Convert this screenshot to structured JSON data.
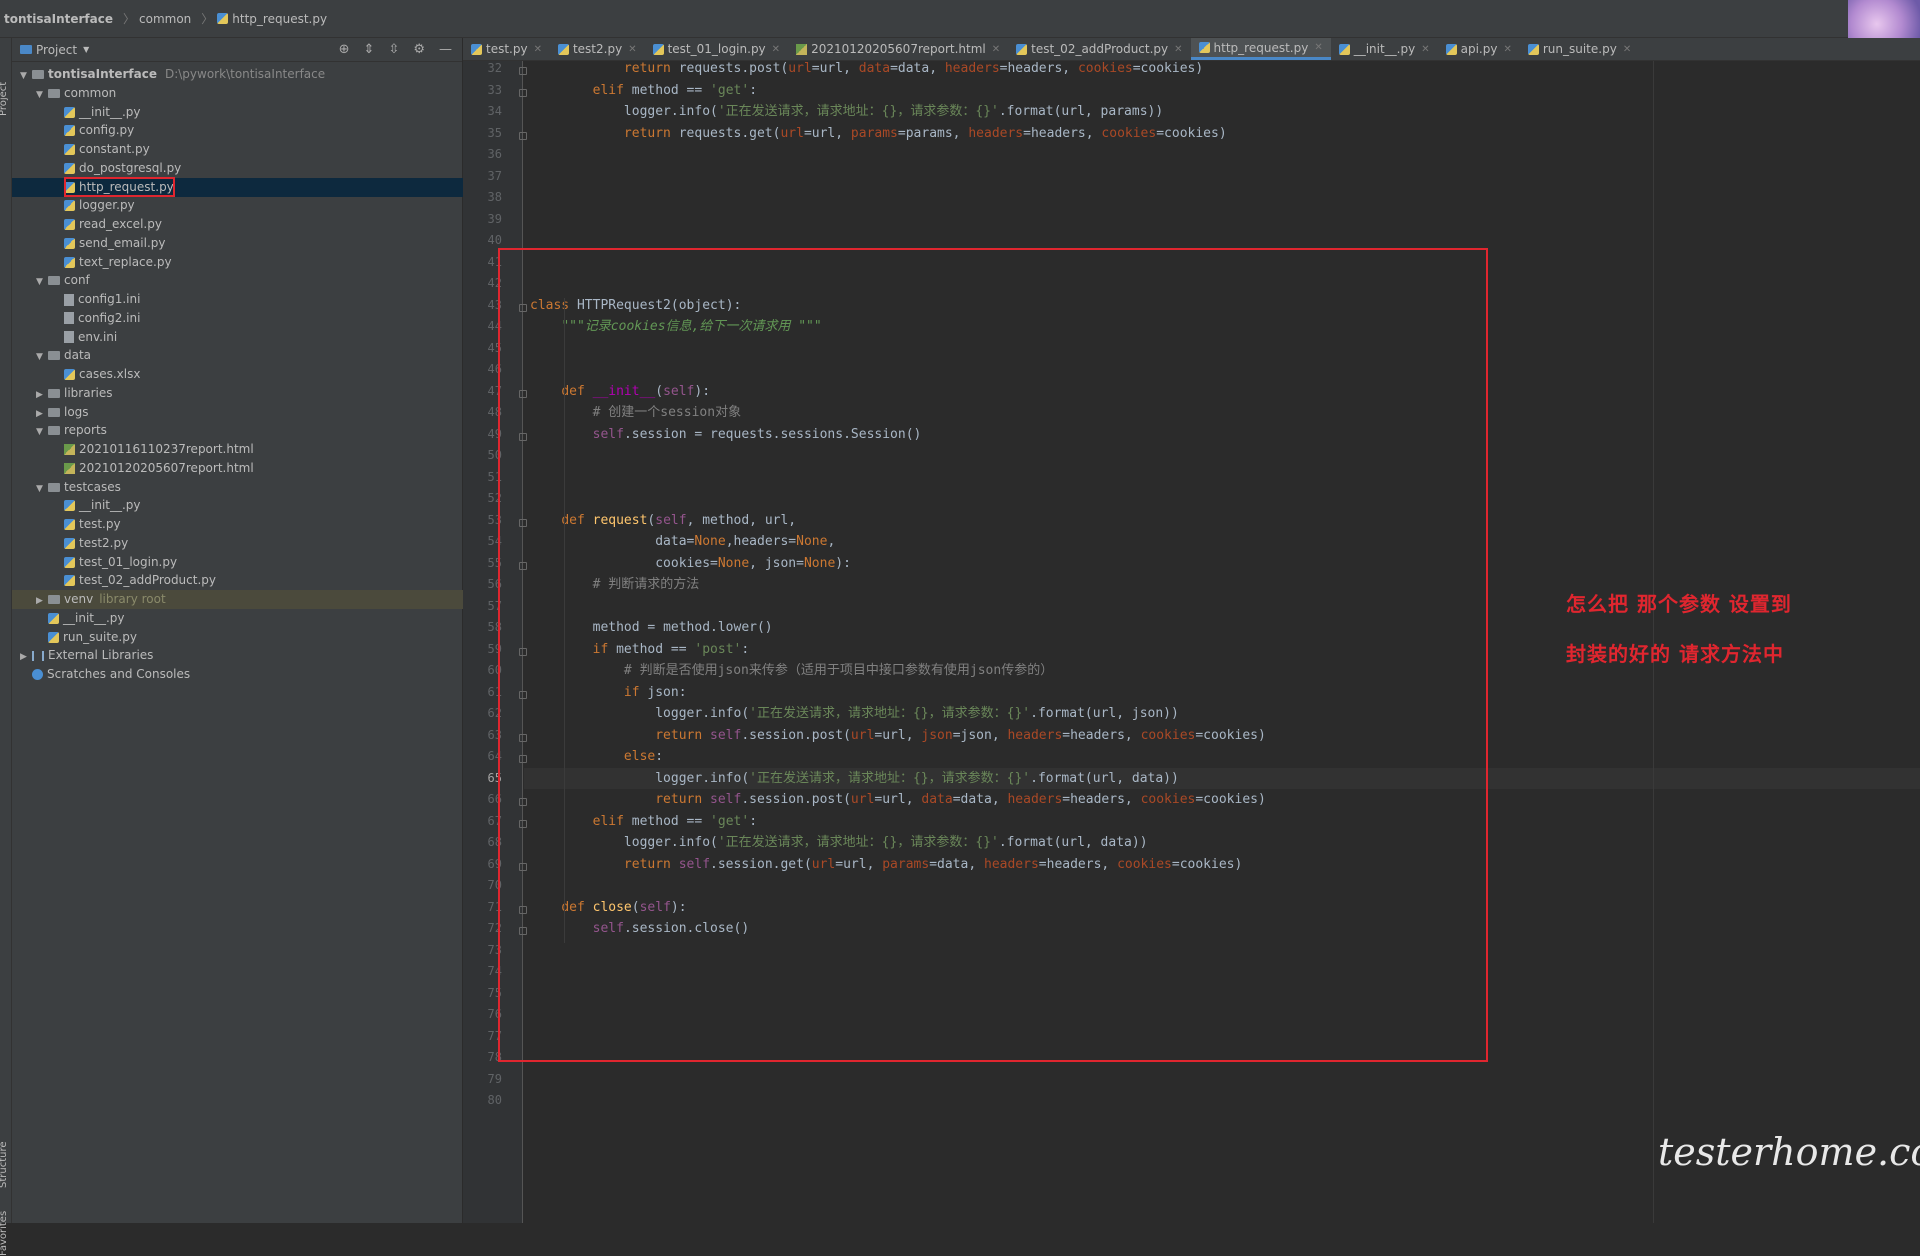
{
  "breadcrumb": [
    "tontisaInterface",
    "common",
    "http_request.py"
  ],
  "project_panel": {
    "title": "Project",
    "left_tool_labels": [
      "Project",
      "Structure",
      "Favorites"
    ],
    "tree": [
      {
        "label": "tontisaInterface",
        "extra": "D:\\pywork\\tontisaInterface",
        "depth": 0,
        "kind": "folder",
        "expanded": true
      },
      {
        "label": "common",
        "depth": 1,
        "kind": "folder",
        "expanded": true
      },
      {
        "label": "__init__.py",
        "depth": 2,
        "kind": "py"
      },
      {
        "label": "config.py",
        "depth": 2,
        "kind": "py"
      },
      {
        "label": "constant.py",
        "depth": 2,
        "kind": "py"
      },
      {
        "label": "do_postgresql.py",
        "depth": 2,
        "kind": "py"
      },
      {
        "label": "http_request.py",
        "depth": 2,
        "kind": "py",
        "selected": true
      },
      {
        "label": "logger.py",
        "depth": 2,
        "kind": "py"
      },
      {
        "label": "read_excel.py",
        "depth": 2,
        "kind": "py"
      },
      {
        "label": "send_email.py",
        "depth": 2,
        "kind": "py"
      },
      {
        "label": "text_replace.py",
        "depth": 2,
        "kind": "py"
      },
      {
        "label": "conf",
        "depth": 1,
        "kind": "folder",
        "expanded": true
      },
      {
        "label": "config1.ini",
        "depth": 2,
        "kind": "file"
      },
      {
        "label": "config2.ini",
        "depth": 2,
        "kind": "file"
      },
      {
        "label": "env.ini",
        "depth": 2,
        "kind": "file"
      },
      {
        "label": "data",
        "depth": 1,
        "kind": "folder",
        "expanded": true
      },
      {
        "label": "cases.xlsx",
        "depth": 2,
        "kind": "py"
      },
      {
        "label": "libraries",
        "depth": 1,
        "kind": "folder",
        "expanded": false
      },
      {
        "label": "logs",
        "depth": 1,
        "kind": "folder",
        "expanded": false
      },
      {
        "label": "reports",
        "depth": 1,
        "kind": "folder",
        "expanded": true
      },
      {
        "label": "20210116110237report.html",
        "depth": 2,
        "kind": "html"
      },
      {
        "label": "20210120205607report.html",
        "depth": 2,
        "kind": "html"
      },
      {
        "label": "testcases",
        "depth": 1,
        "kind": "folder",
        "expanded": true
      },
      {
        "label": "__init__.py",
        "depth": 2,
        "kind": "py"
      },
      {
        "label": "test.py",
        "depth": 2,
        "kind": "py"
      },
      {
        "label": "test2.py",
        "depth": 2,
        "kind": "py"
      },
      {
        "label": "test_01_login.py",
        "depth": 2,
        "kind": "py"
      },
      {
        "label": "test_02_addProduct.py",
        "depth": 2,
        "kind": "py"
      },
      {
        "label": "venv",
        "extra": "library root",
        "depth": 1,
        "kind": "folder",
        "expanded": false,
        "highlight": true
      },
      {
        "label": "__init__.py",
        "depth": 1,
        "kind": "py"
      },
      {
        "label": "run_suite.py",
        "depth": 1,
        "kind": "py"
      },
      {
        "label": "External Libraries",
        "depth": 0,
        "kind": "lib",
        "expanded": false
      },
      {
        "label": "Scratches and Consoles",
        "depth": 0,
        "kind": "scratch"
      }
    ]
  },
  "tabs": [
    {
      "label": "test.py"
    },
    {
      "label": "test2.py"
    },
    {
      "label": "test_01_login.py"
    },
    {
      "label": "20210120205607report.html",
      "kind": "html"
    },
    {
      "label": "test_02_addProduct.py"
    },
    {
      "label": "http_request.py",
      "active": true
    },
    {
      "label": "__init__.py"
    },
    {
      "label": "api.py"
    },
    {
      "label": "run_suite.py"
    }
  ],
  "editor": {
    "first_line_number": 32,
    "current_line": 65,
    "lines": [
      [
        {
          "t": "            "
        },
        {
          "t": "return ",
          "c": "kw"
        },
        {
          "t": "requests.post("
        },
        {
          "t": "url",
          "c": "par"
        },
        {
          "t": "=url, "
        },
        {
          "t": "data",
          "c": "par"
        },
        {
          "t": "=data, "
        },
        {
          "t": "headers",
          "c": "par"
        },
        {
          "t": "=headers, "
        },
        {
          "t": "cookies",
          "c": "par"
        },
        {
          "t": "=cookies)"
        }
      ],
      [
        {
          "t": "        "
        },
        {
          "t": "elif ",
          "c": "kw"
        },
        {
          "t": "method == "
        },
        {
          "t": "'get'",
          "c": "str"
        },
        {
          "t": ":"
        }
      ],
      [
        {
          "t": "            "
        },
        {
          "t": "logger.info("
        },
        {
          "t": "'正在发送请求，请求地址：{}，请求参数：{}'",
          "c": "str"
        },
        {
          "t": ".format(url, params))"
        }
      ],
      [
        {
          "t": "            "
        },
        {
          "t": "return ",
          "c": "kw"
        },
        {
          "t": "requests.get("
        },
        {
          "t": "url",
          "c": "par"
        },
        {
          "t": "=url, "
        },
        {
          "t": "params",
          "c": "par"
        },
        {
          "t": "=params, "
        },
        {
          "t": "headers",
          "c": "par"
        },
        {
          "t": "=headers, "
        },
        {
          "t": "cookies",
          "c": "par"
        },
        {
          "t": "=cookies)"
        }
      ],
      [],
      [],
      [],
      [],
      [],
      [],
      [],
      [
        {
          "t": "class ",
          "c": "kw"
        },
        {
          "t": "HTTPRequest2("
        },
        {
          "t": "object",
          "c": "fg"
        },
        {
          "t": "):"
        }
      ],
      [
        {
          "t": "    "
        },
        {
          "t": "\"\"\"记录cookies信息,给下一次请求用 \"\"\"",
          "c": "doc"
        }
      ],
      [],
      [],
      [
        {
          "t": "    "
        },
        {
          "t": "def ",
          "c": "kw"
        },
        {
          "t": "__init__",
          "c": "mag"
        },
        {
          "t": "("
        },
        {
          "t": "self",
          "c": "slf"
        },
        {
          "t": "):"
        }
      ],
      [
        {
          "t": "        "
        },
        {
          "t": "# 创建一个session对象",
          "c": "cmt"
        }
      ],
      [
        {
          "t": "        "
        },
        {
          "t": "self",
          "c": "slf"
        },
        {
          "t": ".session = requests.sessions.Session()"
        }
      ],
      [],
      [],
      [],
      [
        {
          "t": "    "
        },
        {
          "t": "def ",
          "c": "kw"
        },
        {
          "t": "request",
          "c": "fn"
        },
        {
          "t": "("
        },
        {
          "t": "self",
          "c": "slf"
        },
        {
          "t": ", method, url,"
        }
      ],
      [
        {
          "t": "                "
        },
        {
          "t": "data="
        },
        {
          "t": "None",
          "c": "kw"
        },
        {
          "t": ",headers="
        },
        {
          "t": "None",
          "c": "kw"
        },
        {
          "t": ","
        }
      ],
      [
        {
          "t": "                "
        },
        {
          "t": "cookies="
        },
        {
          "t": "None",
          "c": "kw"
        },
        {
          "t": ", json="
        },
        {
          "t": "None",
          "c": "kw"
        },
        {
          "t": "):"
        }
      ],
      [
        {
          "t": "        "
        },
        {
          "t": "# 判断请求的方法",
          "c": "cmt"
        }
      ],
      [],
      [
        {
          "t": "        "
        },
        {
          "t": "method = method.lower()"
        }
      ],
      [
        {
          "t": "        "
        },
        {
          "t": "if ",
          "c": "kw"
        },
        {
          "t": "method == "
        },
        {
          "t": "'post'",
          "c": "str"
        },
        {
          "t": ":"
        }
      ],
      [
        {
          "t": "            "
        },
        {
          "t": "# 判断是否使用json来传参（适用于项目中接口参数有使用json传参的）",
          "c": "cmt"
        }
      ],
      [
        {
          "t": "            "
        },
        {
          "t": "if ",
          "c": "kw"
        },
        {
          "t": "json:"
        }
      ],
      [
        {
          "t": "                "
        },
        {
          "t": "logger.info("
        },
        {
          "t": "'正在发送请求，请求地址：{}，请求参数：{}'",
          "c": "str"
        },
        {
          "t": ".format(url, json))"
        }
      ],
      [
        {
          "t": "                "
        },
        {
          "t": "return ",
          "c": "kw"
        },
        {
          "t": "self",
          "c": "slf"
        },
        {
          "t": ".session.post("
        },
        {
          "t": "url",
          "c": "par"
        },
        {
          "t": "=url, "
        },
        {
          "t": "json",
          "c": "par"
        },
        {
          "t": "=json, "
        },
        {
          "t": "headers",
          "c": "par"
        },
        {
          "t": "=headers, "
        },
        {
          "t": "cookies",
          "c": "par"
        },
        {
          "t": "=cookies)"
        }
      ],
      [
        {
          "t": "            "
        },
        {
          "t": "else",
          "c": "kw"
        },
        {
          "t": ":"
        }
      ],
      [
        {
          "t": "                "
        },
        {
          "t": "logger.info("
        },
        {
          "t": "'正在发送请求，请求地址：{}，请求参数：{}'",
          "c": "str"
        },
        {
          "t": ".format(url, data))"
        }
      ],
      [
        {
          "t": "                "
        },
        {
          "t": "return ",
          "c": "kw"
        },
        {
          "t": "self",
          "c": "slf"
        },
        {
          "t": ".session.post("
        },
        {
          "t": "url",
          "c": "par"
        },
        {
          "t": "=url, "
        },
        {
          "t": "data",
          "c": "par"
        },
        {
          "t": "=data, "
        },
        {
          "t": "headers",
          "c": "par"
        },
        {
          "t": "=headers, "
        },
        {
          "t": "cookies",
          "c": "par"
        },
        {
          "t": "=cookies)"
        }
      ],
      [
        {
          "t": "        "
        },
        {
          "t": "elif ",
          "c": "kw"
        },
        {
          "t": "method == "
        },
        {
          "t": "'get'",
          "c": "str"
        },
        {
          "t": ":"
        }
      ],
      [
        {
          "t": "            "
        },
        {
          "t": "logger.info("
        },
        {
          "t": "'正在发送请求，请求地址：{}，请求参数：{}'",
          "c": "str"
        },
        {
          "t": ".format(url, data))"
        }
      ],
      [
        {
          "t": "            "
        },
        {
          "t": "return ",
          "c": "kw"
        },
        {
          "t": "self",
          "c": "slf"
        },
        {
          "t": ".session.get("
        },
        {
          "t": "url",
          "c": "par"
        },
        {
          "t": "=url, "
        },
        {
          "t": "params",
          "c": "par"
        },
        {
          "t": "=data, "
        },
        {
          "t": "headers",
          "c": "par"
        },
        {
          "t": "=headers, "
        },
        {
          "t": "cookies",
          "c": "par"
        },
        {
          "t": "=cookies)"
        }
      ],
      [],
      [
        {
          "t": "    "
        },
        {
          "t": "def ",
          "c": "kw"
        },
        {
          "t": "close",
          "c": "fn"
        },
        {
          "t": "("
        },
        {
          "t": "self",
          "c": "slf"
        },
        {
          "t": "):"
        }
      ],
      [
        {
          "t": "        "
        },
        {
          "t": "self",
          "c": "slf"
        },
        {
          "t": ".session.close()"
        }
      ],
      [],
      [],
      [],
      [],
      [],
      [],
      [],
      []
    ]
  },
  "annotation": [
    "怎么把 那个参数 设置到",
    "封装的好的 请求方法中"
  ],
  "watermark": "testerhome.com",
  "colors": {
    "highlight_box": "#e0262f",
    "keyword": "#cc7832",
    "string": "#6a8759",
    "self": "#94558d",
    "param": "#aa4926"
  }
}
